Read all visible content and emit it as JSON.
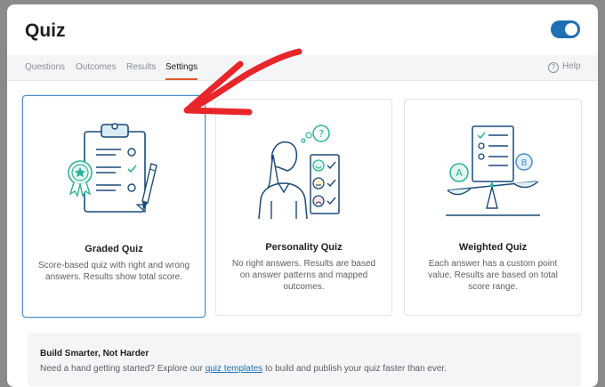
{
  "modal": {
    "title": "Quiz"
  },
  "tabs": [
    {
      "label": "Questions"
    },
    {
      "label": "Outcomes"
    },
    {
      "label": "Results"
    },
    {
      "label": "Settings"
    }
  ],
  "help": {
    "label": "Help"
  },
  "cards": [
    {
      "title": "Graded Quiz",
      "desc": "Score-based quiz with right and wrong answers. Results show total score."
    },
    {
      "title": "Personality Quiz",
      "desc": "No right answers. Results are based on answer patterns and mapped outcomes."
    },
    {
      "title": "Weighted Quiz",
      "desc": "Each answer has a custom point value. Results are based on total score range."
    }
  ],
  "bottom": {
    "title": "Build Smarter, Not Harder",
    "text_before": "Need a hand getting started? Explore our ",
    "link": "quiz templates",
    "text_after": " to build and publish your quiz faster than ever."
  },
  "colors": {
    "accent": "#1e6fb3",
    "tab_active": "#e25a2b",
    "annotation": "#e8262a",
    "illustration": "#1a4a7a",
    "illustration_accent": "#29b39a"
  }
}
